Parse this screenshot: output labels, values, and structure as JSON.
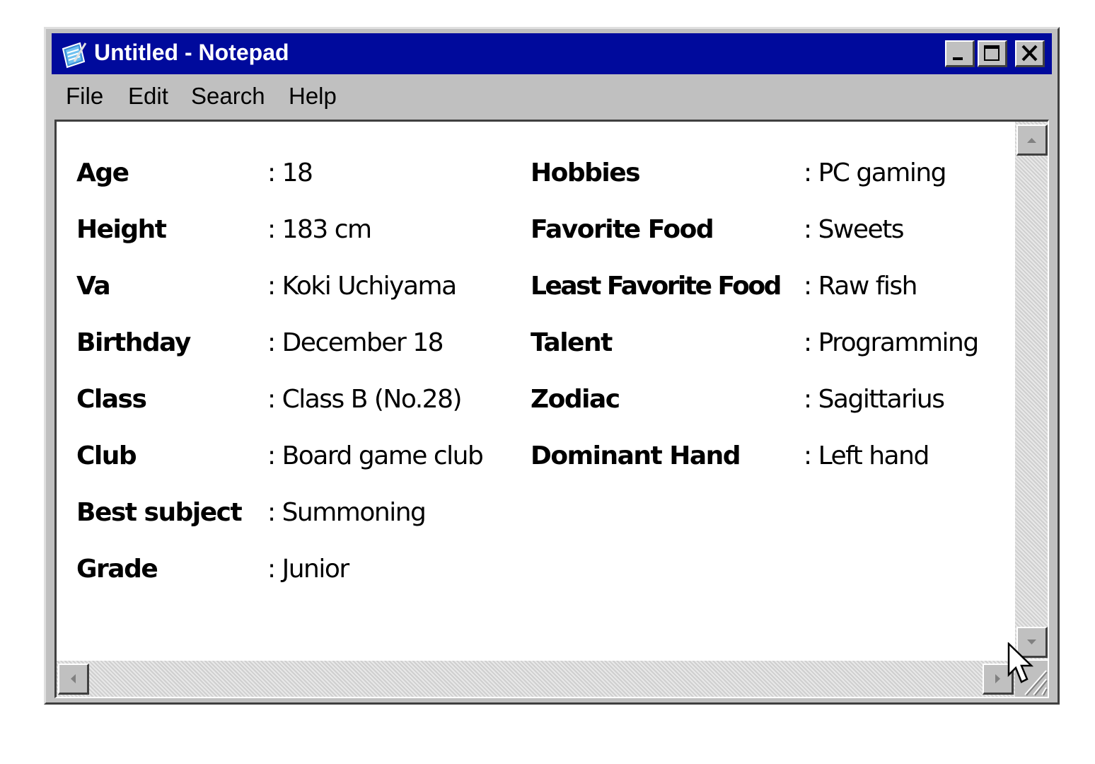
{
  "window": {
    "title": "Untitled - Notepad",
    "app_icon": "notepad-icon"
  },
  "title_buttons": {
    "minimize_icon": "minimize-icon",
    "maximize_icon": "maximize-icon",
    "close_icon": "close-icon"
  },
  "menu": {
    "items": [
      {
        "label": "File"
      },
      {
        "label": "Edit"
      },
      {
        "label": "Search"
      },
      {
        "label": "Help"
      }
    ]
  },
  "document": {
    "left_column": [
      {
        "label": "Age",
        "value": ": 18"
      },
      {
        "label": "Height",
        "value": ": 183 cm"
      },
      {
        "label": "Va",
        "value": ": Koki Uchiyama"
      },
      {
        "label": "Birthday",
        "value": ": December 18"
      },
      {
        "label": "Class",
        "value": ": Class B (No.28)"
      },
      {
        "label": "Club",
        "value": ": Board game club"
      },
      {
        "label": "Best subject",
        "value": ": Summoning"
      },
      {
        "label": "Grade",
        "value": ": Junior"
      }
    ],
    "right_column": [
      {
        "label": "Hobbies",
        "value": ": PC gaming"
      },
      {
        "label": "Favorite Food",
        "value": ": Sweets"
      },
      {
        "label": "Least Favorite Food",
        "value": ": Raw fish"
      },
      {
        "label": "Talent",
        "value": ": Programming"
      },
      {
        "label": "Zodiac",
        "value": ": Sagittarius"
      },
      {
        "label": "Dominant Hand",
        "value": ": Left hand"
      }
    ]
  },
  "colors": {
    "titlebar": "#000a9c",
    "chrome": "#c0c0c0",
    "text": "#000000",
    "background": "#ffffff"
  }
}
